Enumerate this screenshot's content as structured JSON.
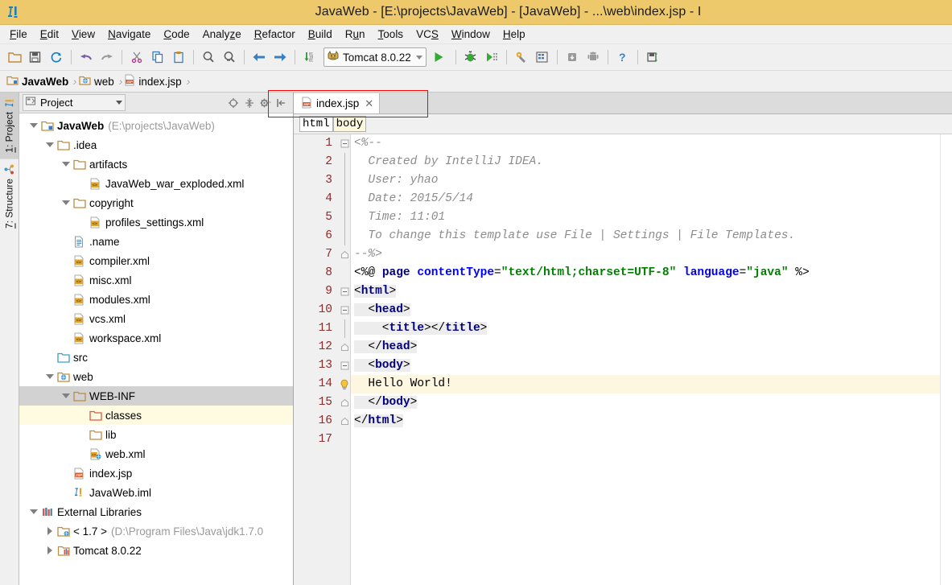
{
  "window": {
    "title": "JavaWeb - [E:\\projects\\JavaWeb] - [JavaWeb] - ...\\web\\index.jsp - I",
    "app_icon": "intellij-idea-icon",
    "accent_color": "#eec96b",
    "annotation_color": "#ff0000"
  },
  "menubar": {
    "items": [
      {
        "label": "File",
        "mnemonic": "F"
      },
      {
        "label": "Edit",
        "mnemonic": "E"
      },
      {
        "label": "View",
        "mnemonic": "V"
      },
      {
        "label": "Navigate",
        "mnemonic": "N"
      },
      {
        "label": "Code",
        "mnemonic": "C"
      },
      {
        "label": "Analyze",
        "mnemonic": "z"
      },
      {
        "label": "Refactor",
        "mnemonic": "R"
      },
      {
        "label": "Build",
        "mnemonic": "B"
      },
      {
        "label": "Run",
        "mnemonic": "u"
      },
      {
        "label": "Tools",
        "mnemonic": "T"
      },
      {
        "label": "VCS",
        "mnemonic": "S"
      },
      {
        "label": "Window",
        "mnemonic": "W"
      },
      {
        "label": "Help",
        "mnemonic": "H"
      }
    ]
  },
  "toolbar": {
    "buttons": [
      {
        "name": "open-folder-icon",
        "tooltip": "Open"
      },
      {
        "name": "save-all-icon",
        "tooltip": "Save All"
      },
      {
        "name": "synchronize-icon",
        "tooltip": "Synchronize"
      },
      {
        "name": "undo-icon",
        "tooltip": "Undo"
      },
      {
        "name": "redo-icon",
        "tooltip": "Redo"
      },
      {
        "name": "cut-icon",
        "tooltip": "Cut"
      },
      {
        "name": "copy-icon",
        "tooltip": "Copy"
      },
      {
        "name": "paste-icon",
        "tooltip": "Paste"
      },
      {
        "name": "find-icon",
        "tooltip": "Find"
      },
      {
        "name": "replace-icon",
        "tooltip": "Replace"
      },
      {
        "name": "back-icon",
        "tooltip": "Back"
      },
      {
        "name": "forward-icon",
        "tooltip": "Forward"
      },
      {
        "name": "compile-icon",
        "tooltip": "Compile"
      }
    ],
    "run_config": {
      "label": "Tomcat 8.0.22",
      "icon": "tomcat-icon",
      "dropdown_icon": "chevron-down-icon"
    },
    "run_button": "run-icon",
    "right_buttons": [
      {
        "name": "debug-icon",
        "tooltip": "Debug"
      },
      {
        "name": "run-with-coverage-icon",
        "tooltip": "Run with Coverage"
      },
      {
        "name": "project-structure-icon",
        "tooltip": "Project Structure"
      },
      {
        "name": "settings-icon",
        "tooltip": "Settings"
      },
      {
        "name": "sdk-manager-icon",
        "tooltip": "SDK Manager"
      },
      {
        "name": "avd-manager-icon",
        "tooltip": "AVD Manager"
      },
      {
        "name": "help-icon",
        "tooltip": "Help"
      },
      {
        "name": "save-icon",
        "tooltip": "Save"
      }
    ]
  },
  "breadcrumb_bar": {
    "items": [
      {
        "label": "JavaWeb",
        "icon": "module-icon",
        "bold": true
      },
      {
        "label": "web",
        "icon": "web-folder-icon",
        "bold": false
      },
      {
        "label": "index.jsp",
        "icon": "jsp-file-icon",
        "bold": false
      }
    ]
  },
  "tool_window_tabs": [
    {
      "label": "1: Project",
      "number": "1",
      "text": ": Project",
      "icon": "project-icon",
      "active": true
    },
    {
      "label": "7: Structure",
      "number": "7",
      "text": ": Structure",
      "icon": "structure-icon",
      "active": false
    }
  ],
  "project_panel": {
    "combo_label": "Project",
    "combo_icon": "project-view-icon",
    "actions": [
      {
        "name": "scroll-from-source-icon"
      },
      {
        "name": "collapse-all-icon"
      },
      {
        "name": "settings-gear-icon"
      },
      {
        "name": "hide-panel-icon"
      }
    ],
    "tree": [
      {
        "label": "JavaWeb",
        "sub": "(E:\\projects\\JavaWeb)",
        "depth": 0,
        "twisty": "down",
        "icon": "module-root-icon",
        "bold": true,
        "state": "normal"
      },
      {
        "label": ".idea",
        "sub": "",
        "depth": 1,
        "twisty": "down",
        "icon": "folder-icon",
        "bold": false,
        "state": "normal"
      },
      {
        "label": "artifacts",
        "sub": "",
        "depth": 2,
        "twisty": "down",
        "icon": "folder-icon",
        "bold": false,
        "state": "normal"
      },
      {
        "label": "JavaWeb_war_exploded.xml",
        "sub": "",
        "depth": 3,
        "twisty": "none",
        "icon": "xml-file-icon",
        "bold": false,
        "state": "normal"
      },
      {
        "label": "copyright",
        "sub": "",
        "depth": 2,
        "twisty": "down",
        "icon": "folder-icon",
        "bold": false,
        "state": "normal"
      },
      {
        "label": "profiles_settings.xml",
        "sub": "",
        "depth": 3,
        "twisty": "none",
        "icon": "xml-file-icon",
        "bold": false,
        "state": "normal"
      },
      {
        "label": ".name",
        "sub": "",
        "depth": 2,
        "twisty": "none",
        "icon": "text-file-icon",
        "bold": false,
        "state": "normal"
      },
      {
        "label": "compiler.xml",
        "sub": "",
        "depth": 2,
        "twisty": "none",
        "icon": "xml-file-icon",
        "bold": false,
        "state": "normal"
      },
      {
        "label": "misc.xml",
        "sub": "",
        "depth": 2,
        "twisty": "none",
        "icon": "xml-file-icon",
        "bold": false,
        "state": "normal"
      },
      {
        "label": "modules.xml",
        "sub": "",
        "depth": 2,
        "twisty": "none",
        "icon": "xml-file-icon",
        "bold": false,
        "state": "normal"
      },
      {
        "label": "vcs.xml",
        "sub": "",
        "depth": 2,
        "twisty": "none",
        "icon": "xml-file-icon",
        "bold": false,
        "state": "normal"
      },
      {
        "label": "workspace.xml",
        "sub": "",
        "depth": 2,
        "twisty": "none",
        "icon": "xml-file-icon",
        "bold": false,
        "state": "normal"
      },
      {
        "label": "src",
        "sub": "",
        "depth": 1,
        "twisty": "none",
        "icon": "source-folder-icon",
        "bold": false,
        "state": "normal"
      },
      {
        "label": "web",
        "sub": "",
        "depth": 1,
        "twisty": "down",
        "icon": "web-folder-icon",
        "bold": false,
        "state": "normal"
      },
      {
        "label": "WEB-INF",
        "sub": "",
        "depth": 2,
        "twisty": "down",
        "icon": "folder-icon",
        "bold": false,
        "state": "selected"
      },
      {
        "label": "classes",
        "sub": "",
        "depth": 3,
        "twisty": "none",
        "icon": "excluded-folder-icon",
        "bold": false,
        "state": "marked"
      },
      {
        "label": "lib",
        "sub": "",
        "depth": 3,
        "twisty": "none",
        "icon": "folder-icon",
        "bold": false,
        "state": "normal"
      },
      {
        "label": "web.xml",
        "sub": "",
        "depth": 3,
        "twisty": "none",
        "icon": "web-xml-icon",
        "bold": false,
        "state": "normal"
      },
      {
        "label": "index.jsp",
        "sub": "",
        "depth": 2,
        "twisty": "none",
        "icon": "jsp-file-icon",
        "bold": false,
        "state": "normal"
      },
      {
        "label": "JavaWeb.iml",
        "sub": "",
        "depth": 2,
        "twisty": "none",
        "icon": "iml-file-icon",
        "bold": false,
        "state": "normal"
      },
      {
        "label": "External Libraries",
        "sub": "",
        "depth": 0,
        "twisty": "down",
        "icon": "libraries-icon",
        "bold": false,
        "state": "normal"
      },
      {
        "label": "< 1.7 >",
        "sub": "(D:\\Program Files\\Java\\jdk1.7.0",
        "depth": 1,
        "twisty": "right",
        "icon": "jdk-icon",
        "bold": false,
        "state": "normal"
      },
      {
        "label": "Tomcat 8.0.22",
        "sub": "",
        "depth": 1,
        "twisty": "right",
        "icon": "library-icon",
        "bold": false,
        "state": "normal"
      }
    ]
  },
  "editor": {
    "tabs": [
      {
        "label": "index.jsp",
        "icon": "jsp-file-icon",
        "close_icon": "close-icon",
        "active": true
      }
    ],
    "breadcrumbs": [
      {
        "label": "html",
        "highlighted": false
      },
      {
        "label": "body",
        "highlighted": true
      }
    ],
    "filename": "index.jsp",
    "total_lines": 17,
    "current_line": 14,
    "lines": [
      {
        "n": 1,
        "fold": "start",
        "current": false,
        "bulb": false,
        "tokens": [
          {
            "t": "<%--",
            "c": "cmt"
          }
        ]
      },
      {
        "n": 2,
        "fold": "body",
        "current": false,
        "bulb": false,
        "tokens": [
          {
            "t": "  Created by IntelliJ IDEA.",
            "c": "cmt"
          }
        ]
      },
      {
        "n": 3,
        "fold": "body",
        "current": false,
        "bulb": false,
        "tokens": [
          {
            "t": "  User: yhao",
            "c": "cmt"
          }
        ]
      },
      {
        "n": 4,
        "fold": "body",
        "current": false,
        "bulb": false,
        "tokens": [
          {
            "t": "  Date: 2015/5/14",
            "c": "cmt"
          }
        ]
      },
      {
        "n": 5,
        "fold": "body",
        "current": false,
        "bulb": false,
        "tokens": [
          {
            "t": "  Time: 11:01",
            "c": "cmt"
          }
        ]
      },
      {
        "n": 6,
        "fold": "body",
        "current": false,
        "bulb": false,
        "tokens": [
          {
            "t": "  To change this template use File | Settings | File Templates.",
            "c": "cmt"
          }
        ]
      },
      {
        "n": 7,
        "fold": "end",
        "current": false,
        "bulb": false,
        "tokens": [
          {
            "t": "--%>",
            "c": "cmt"
          }
        ]
      },
      {
        "n": 8,
        "fold": "none",
        "current": false,
        "bulb": false,
        "directive": true,
        "tokens": [
          {
            "t": "<%@ ",
            "c": "punct"
          },
          {
            "t": "page ",
            "c": "kw"
          },
          {
            "t": "contentType",
            "c": "attr"
          },
          {
            "t": "=",
            "c": "punct"
          },
          {
            "t": "\"text/html;charset=UTF-8\"",
            "c": "str"
          },
          {
            "t": " ",
            "c": "punct"
          },
          {
            "t": "language",
            "c": "attr"
          },
          {
            "t": "=",
            "c": "punct"
          },
          {
            "t": "\"java\"",
            "c": "str"
          },
          {
            "t": " %>",
            "c": "punct"
          }
        ]
      },
      {
        "n": 9,
        "fold": "start",
        "current": false,
        "bulb": false,
        "tokens": [
          {
            "t": "<",
            "c": "punct-tag"
          },
          {
            "t": "html",
            "c": "kw-tag"
          },
          {
            "t": ">",
            "c": "punct-tag"
          }
        ]
      },
      {
        "n": 10,
        "fold": "start",
        "current": false,
        "bulb": false,
        "tokens": [
          {
            "t": "  <",
            "c": "punct-tag"
          },
          {
            "t": "head",
            "c": "kw-tag"
          },
          {
            "t": ">",
            "c": "punct-tag"
          }
        ]
      },
      {
        "n": 11,
        "fold": "body",
        "current": false,
        "bulb": false,
        "tokens": [
          {
            "t": "    <",
            "c": "punct-tag"
          },
          {
            "t": "title",
            "c": "kw-tag"
          },
          {
            "t": "></",
            "c": "punct-tag"
          },
          {
            "t": "title",
            "c": "kw-tag"
          },
          {
            "t": ">",
            "c": "punct-tag"
          }
        ]
      },
      {
        "n": 12,
        "fold": "end",
        "current": false,
        "bulb": false,
        "tokens": [
          {
            "t": "  </",
            "c": "punct-tag"
          },
          {
            "t": "head",
            "c": "kw-tag"
          },
          {
            "t": ">",
            "c": "punct-tag"
          }
        ]
      },
      {
        "n": 13,
        "fold": "start",
        "current": false,
        "bulb": false,
        "tokens": [
          {
            "t": "  <",
            "c": "punct-tag"
          },
          {
            "t": "body",
            "c": "kw-tag"
          },
          {
            "t": ">",
            "c": "punct-tag"
          }
        ]
      },
      {
        "n": 14,
        "fold": "body",
        "current": true,
        "bulb": true,
        "tokens": [
          {
            "t": "  Hello World!",
            "c": "plain"
          }
        ]
      },
      {
        "n": 15,
        "fold": "end",
        "current": false,
        "bulb": false,
        "tokens": [
          {
            "t": "  </",
            "c": "punct-tag"
          },
          {
            "t": "body",
            "c": "kw-tag"
          },
          {
            "t": ">",
            "c": "punct-tag"
          }
        ]
      },
      {
        "n": 16,
        "fold": "end",
        "current": false,
        "bulb": false,
        "tokens": [
          {
            "t": "</",
            "c": "punct-tag"
          },
          {
            "t": "html",
            "c": "kw-tag"
          },
          {
            "t": ">",
            "c": "punct-tag"
          }
        ]
      },
      {
        "n": 17,
        "fold": "none",
        "current": false,
        "bulb": false,
        "tokens": []
      }
    ]
  }
}
